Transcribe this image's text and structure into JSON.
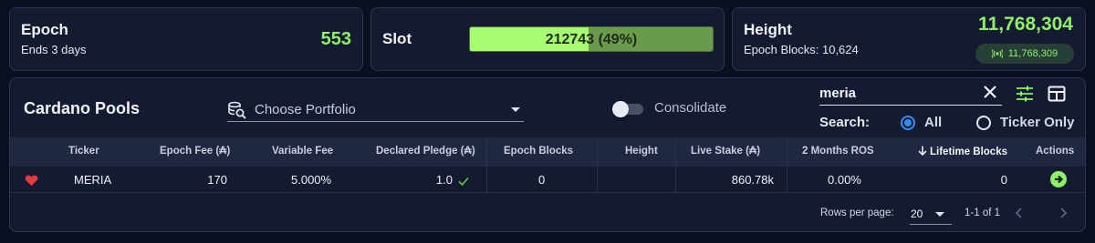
{
  "epoch": {
    "title": "Epoch",
    "sub": "Ends 3 days",
    "value": "553"
  },
  "slot": {
    "title": "Slot",
    "text": "212743 (49%)",
    "progress": 0.49
  },
  "height": {
    "title": "Height",
    "sub": "Epoch Blocks: 10,624",
    "value": "11,768,304",
    "network": "11,768,309"
  },
  "pools": {
    "title": "Cardano Pools",
    "portfolio_placeholder": "Choose Portfolio",
    "consolidate_label": "Consolidate",
    "consolidate_on": false,
    "search_value": "meria",
    "search_label": "Search:",
    "search_options": [
      "All",
      "Ticker Only"
    ],
    "search_selected": "All",
    "columns": [
      "Ticker",
      "Epoch Fee (₳)",
      "Variable Fee",
      "Declared Pledge (₳)",
      "Epoch Blocks",
      "Height",
      "Live Stake (₳)",
      "2 Months ROS",
      "Lifetime Blocks",
      "Actions"
    ],
    "sort_column": "Lifetime Blocks",
    "sort_dir": "desc",
    "rows": [
      {
        "favorite": true,
        "ticker": "MERIA",
        "epoch_fee": "170",
        "variable_fee": "5.000%",
        "pledge": "1.0",
        "pledge_met": true,
        "epoch_blocks": "0",
        "height": "",
        "live_stake": "860.78k",
        "ros": "0.00%",
        "lifetime_blocks": "0"
      }
    ],
    "rows_per_page_label": "Rows per page:",
    "rows_per_page": "20",
    "range": "1-1 of 1"
  },
  "colors": {
    "accent_green": "#8ef06a",
    "radio_blue": "#2f8ff5",
    "card_bg": "#141a30",
    "page_bg": "#0b1020",
    "heart_red": "#e8393c"
  },
  "icons": [
    "portfolio-search-icon",
    "clear-icon",
    "tune-icon",
    "grid-icon",
    "broadcast-icon",
    "heart-icon",
    "check-icon",
    "arrow-right-icon",
    "sort-arrow-icon",
    "chevron-left-icon",
    "chevron-right-icon"
  ]
}
